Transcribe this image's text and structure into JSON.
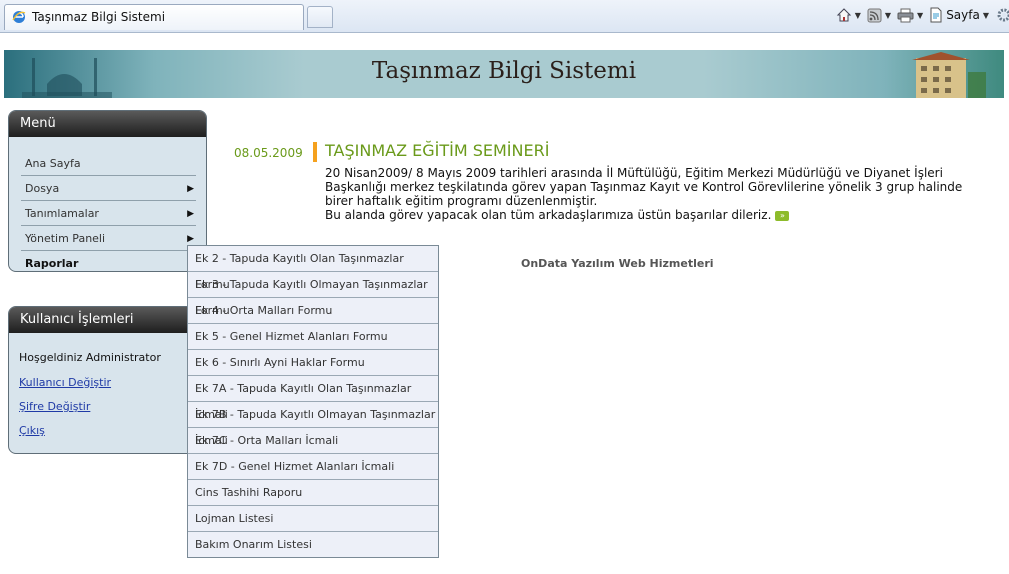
{
  "browser": {
    "tab_title": "Taşınmaz Bilgi Sistemi",
    "toolbar": {
      "page_label": "Sayfa"
    }
  },
  "header": {
    "title": "Taşınmaz Bilgi Sistemi"
  },
  "menu": {
    "title": "Menü",
    "items": [
      {
        "label": "Ana Sayfa"
      },
      {
        "label": "Dosya"
      },
      {
        "label": "Tanımlamalar"
      },
      {
        "label": "Yönetim Paneli"
      },
      {
        "label": "Raporlar"
      }
    ]
  },
  "submenu": {
    "items": [
      "Ek 2 - Tapuda Kayıtlı Olan Taşınmazlar Formu",
      "Ek 3 - Tapuda Kayıtlı Olmayan Taşınmazlar Formu",
      "Ek 4 - Orta Malları Formu",
      "Ek 5 - Genel Hizmet Alanları Formu",
      "Ek 6 - Sınırlı Ayni Haklar Formu",
      "Ek 7A - Tapuda Kayıtlı Olan Taşınmazlar İcmali",
      "Ek 7B - Tapuda Kayıtlı Olmayan Taşınmazlar İcmali",
      "Ek 7C - Orta Malları İcmali",
      "Ek 7D - Genel Hizmet Alanları İcmali",
      "Cins Tashihi Raporu",
      "Lojman Listesi",
      "Bakım Onarım Listesi"
    ]
  },
  "user_panel": {
    "title": "Kullanıcı İşlemleri",
    "greeting": "Hoşgeldiniz Administrator",
    "links": [
      "Kullanıcı Değiştir",
      "Şifre Değiştir",
      "Çıkış"
    ]
  },
  "news": {
    "date": "08.05.2009",
    "title": "TAŞINMAZ EĞİTİM SEMİNERİ",
    "paragraph1": "20 Nisan2009/ 8 Mayıs 2009 tarihleri arasında İl Müftülüğü, Eğitim Merkezi Müdürlüğü ve Diyanet İşleri Başkanlığı merkez teşkilatında görev yapan Taşınmaz Kayıt ve Kontrol Görevlilerine yönelik 3 grup halinde birer haftalık eğitim programı düzenlenmiştir.",
    "paragraph2": "Bu alanda görev yapacak olan tüm arkadaşlarımıza üstün başarılar dileriz."
  },
  "footer": {
    "text": "OnData Yazılım Web Hizmetleri"
  },
  "colors": {
    "accent_green": "#6a9a1a",
    "bar_orange": "#f5a11e",
    "link_blue": "#1f3aa6"
  }
}
